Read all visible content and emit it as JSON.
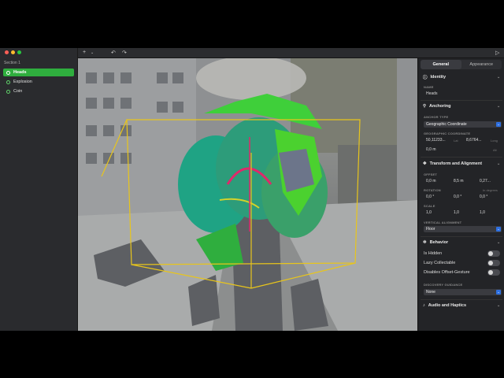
{
  "sidebar": {
    "section_title": "Section 1",
    "items": [
      {
        "label": "Heads",
        "selected": true
      },
      {
        "label": "Explosion",
        "selected": false
      },
      {
        "label": "Coin",
        "selected": false
      }
    ]
  },
  "toolbar": {
    "add_label": "+",
    "add_caret": "⌄",
    "undo_label": "↶",
    "redo_label": "↷",
    "play_label": "▷"
  },
  "inspector": {
    "tabs": [
      "General",
      "Appearance"
    ],
    "identity": {
      "title": "Identity",
      "name_label": "NAME",
      "name_value": "Heads"
    },
    "anchoring": {
      "title": "Anchoring",
      "anchor_type_label": "ANCHOR TYPE",
      "anchor_type_value": "Geographic Coordinate",
      "geo_label": "GEOGRAPHIC COORDINATE",
      "lat_value": "50,11233...",
      "lat_unit": "Lat",
      "long_value": "8,6764...",
      "long_unit": "Long",
      "alt_value": "0,0 m",
      "alt_unit": "Alt"
    },
    "transform": {
      "title": "Transform and Alignment",
      "offset_label": "OFFSET",
      "offset_values": [
        "0,0 m",
        "8,5 m",
        "0,27..."
      ],
      "rotation_label": "ROTATION",
      "rotation_unit": "In degrees",
      "rotation_values": [
        "0,0 °",
        "0,0 °",
        "0,0 °"
      ],
      "scale_label": "SCALE",
      "scale_values": [
        "1,0",
        "1,0",
        "1,0"
      ],
      "vertical_label": "VERTICAL ALIGNMENT",
      "vertical_value": "Floor"
    },
    "behavior": {
      "title": "Behavior",
      "toggles": [
        {
          "label": "Is Hidden",
          "on": false
        },
        {
          "label": "Lazy Collectable",
          "on": false
        },
        {
          "label": "Disables Offset-Gesture",
          "on": false
        }
      ],
      "discovery_label": "DISCOVERY GUIDANCE",
      "discovery_value": "None"
    },
    "audio": {
      "title": "Audio and Haptics"
    },
    "colors": {
      "selection": "#2fae3e",
      "accent": "#2d6fe0",
      "bounding_box": "#e8c51c"
    }
  }
}
